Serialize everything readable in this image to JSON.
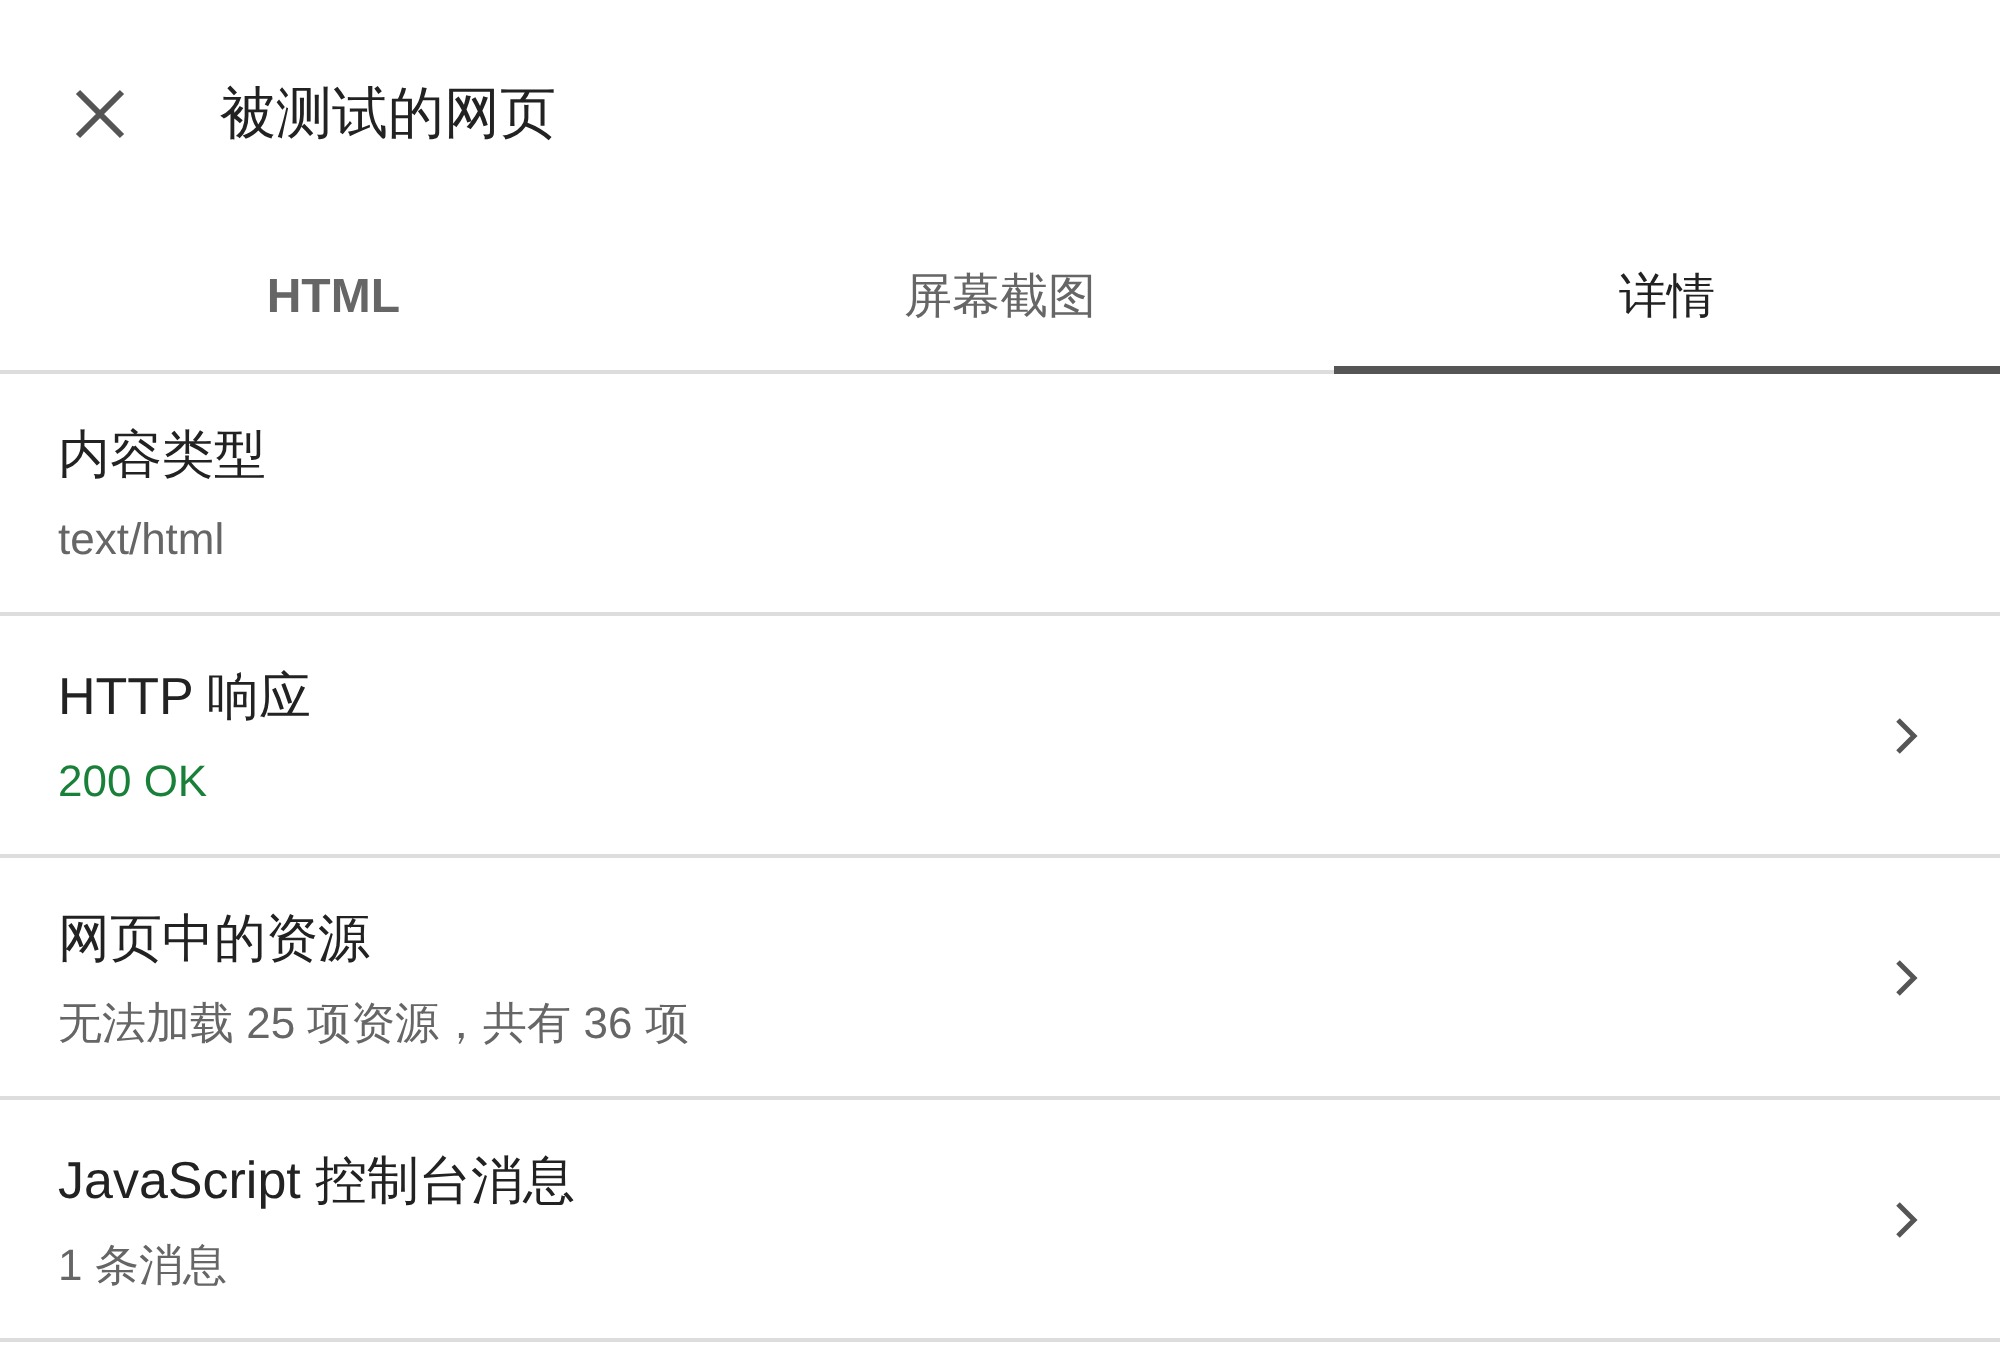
{
  "header": {
    "title": "被测试的网页"
  },
  "tabs": [
    {
      "label": "HTML",
      "selected": false
    },
    {
      "label": "屏幕截图",
      "selected": false
    },
    {
      "label": "详情",
      "selected": true
    }
  ],
  "rows": [
    {
      "title": "内容类型",
      "subtitle": "text/html",
      "kind": "plain",
      "chevron": false
    },
    {
      "title": "HTTP 响应",
      "subtitle": "200 OK",
      "kind": "status",
      "chevron": true
    },
    {
      "title": "网页中的资源",
      "subtitle": "无法加载 25 项资源，共有 36 项",
      "kind": "plain",
      "chevron": true
    },
    {
      "title": "JavaScript 控制台消息",
      "subtitle": "1 条消息",
      "kind": "plain",
      "chevron": true
    }
  ]
}
